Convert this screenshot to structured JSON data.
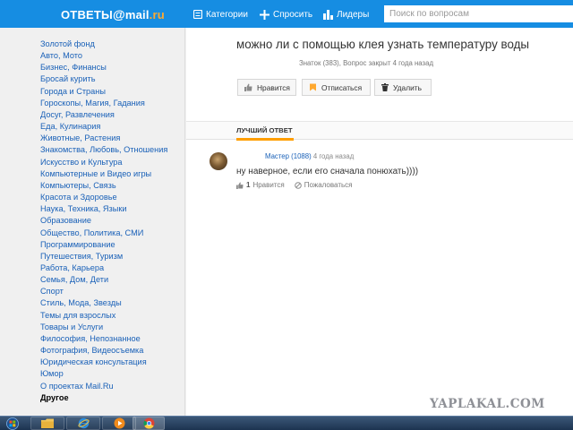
{
  "header": {
    "logo": {
      "text": "ОТВЕТЫ",
      "at": "@",
      "brand": "mail",
      "tld": ".ru"
    },
    "nav": {
      "categories": "Категории",
      "ask": "Спросить",
      "leaders": "Лидеры"
    },
    "search": {
      "placeholder": "Поиск по вопросам",
      "value": ""
    },
    "colors": {
      "bar": "#168de2",
      "accent": "#ffa930"
    }
  },
  "sidebar": {
    "items": [
      {
        "label": "Золотой фонд"
      },
      {
        "label": "Авто, Мото"
      },
      {
        "label": "Бизнес, Финансы"
      },
      {
        "label": "Бросай курить"
      },
      {
        "label": "Города и Страны"
      },
      {
        "label": "Гороскопы, Магия, Гадания"
      },
      {
        "label": "Досуг, Развлечения"
      },
      {
        "label": "Еда, Кулинария"
      },
      {
        "label": "Животные, Растения"
      },
      {
        "label": "Знакомства, Любовь, Отношения"
      },
      {
        "label": "Искусство и Культура"
      },
      {
        "label": "Компьютерные и Видео игры"
      },
      {
        "label": "Компьютеры, Связь"
      },
      {
        "label": "Красота и Здоровье"
      },
      {
        "label": "Наука, Техника, Языки"
      },
      {
        "label": "Образование"
      },
      {
        "label": "Общество, Политика, СМИ"
      },
      {
        "label": "Программирование"
      },
      {
        "label": "Путешествия, Туризм"
      },
      {
        "label": "Работа, Карьера"
      },
      {
        "label": "Семья, Дом, Дети"
      },
      {
        "label": "Спорт"
      },
      {
        "label": "Стиль, Мода, Звезды"
      },
      {
        "label": "Темы для взрослых"
      },
      {
        "label": "Товары и Услуги"
      },
      {
        "label": "Философия, Непознанное"
      },
      {
        "label": "Фотография, Видеосъемка"
      },
      {
        "label": "Юридическая консультация"
      },
      {
        "label": "Юмор"
      },
      {
        "label": "О проектах Mail.Ru"
      },
      {
        "label": "Другое",
        "active": true
      }
    ]
  },
  "question": {
    "title": "можно ли с помощью клея узнать температуру воды",
    "meta": "Знаток (383), Вопрос закрыт 4 года назад",
    "buttons": {
      "like": "Нравится",
      "subscribe": "Отписаться",
      "delete": "Удалить"
    }
  },
  "best_answer": {
    "section_label": "ЛУЧШИЙ ОТВЕТ",
    "author": "Мастер (1088)",
    "time": "4 года назад",
    "text": "ну наверное, если его сначала понюхать))))",
    "likes": "1",
    "like_label": "Нравится",
    "report_label": "Пожаловаться"
  },
  "watermark": "YAPLAKAL.COM",
  "taskbar": {
    "icons": [
      "windows-start-icon",
      "explorer-folder-icon",
      "internet-explorer-icon",
      "media-player-icon",
      "chrome-icon"
    ]
  }
}
